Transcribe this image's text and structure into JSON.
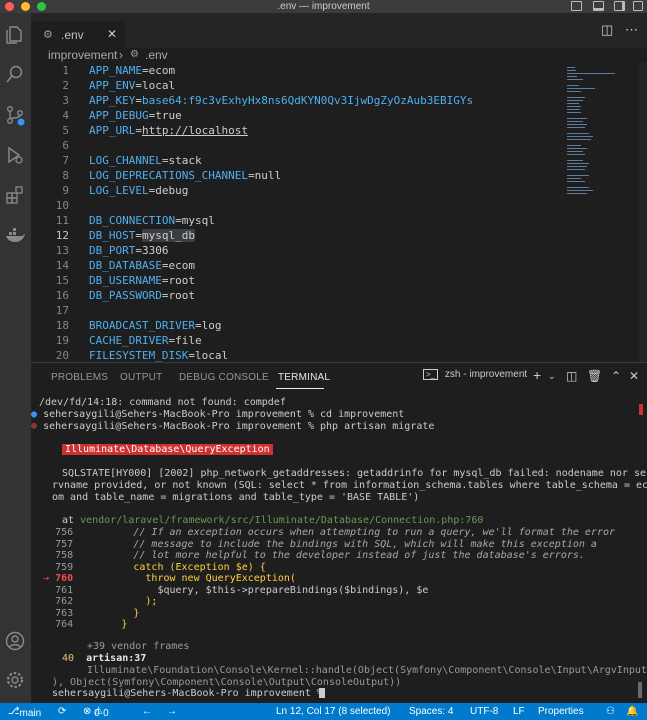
{
  "window": {
    "title": ".env — improvement"
  },
  "tab": {
    "label": ".env",
    "close": "✕"
  },
  "breadcrumb": {
    "folder": "improvement",
    "sep": "›",
    "file": ".env"
  },
  "editor": {
    "current_line": 12,
    "lines": [
      {
        "n": "1",
        "k": "APP_NAME",
        "v": "ecom"
      },
      {
        "n": "2",
        "k": "APP_ENV",
        "v": "local"
      },
      {
        "n": "3",
        "k": "APP_KEY",
        "v": "base64:f9c3vExhyHx8ns6QdKYN0Qv3IjwDgZyOzAub3EBIGYs"
      },
      {
        "n": "4",
        "k": "APP_DEBUG",
        "v": "true"
      },
      {
        "n": "5",
        "k": "APP_URL",
        "v": "http://localhost"
      },
      {
        "n": "6",
        "k": "",
        "v": ""
      },
      {
        "n": "7",
        "k": "LOG_CHANNEL",
        "v": "stack"
      },
      {
        "n": "8",
        "k": "LOG_DEPRECATIONS_CHANNEL",
        "v": "null"
      },
      {
        "n": "9",
        "k": "LOG_LEVEL",
        "v": "debug"
      },
      {
        "n": "10",
        "k": "",
        "v": ""
      },
      {
        "n": "11",
        "k": "DB_CONNECTION",
        "v": "mysql"
      },
      {
        "n": "12",
        "k": "DB_HOST",
        "v": "mysql_db"
      },
      {
        "n": "13",
        "k": "DB_PORT",
        "v": "3306"
      },
      {
        "n": "14",
        "k": "DB_DATABASE",
        "v": "ecom"
      },
      {
        "n": "15",
        "k": "DB_USERNAME",
        "v": "root"
      },
      {
        "n": "16",
        "k": "DB_PASSWORD",
        "v": "root"
      },
      {
        "n": "17",
        "k": "",
        "v": ""
      },
      {
        "n": "18",
        "k": "BROADCAST_DRIVER",
        "v": "log"
      },
      {
        "n": "19",
        "k": "CACHE_DRIVER",
        "v": "file"
      },
      {
        "n": "20",
        "k": "FILESYSTEM_DISK",
        "v": "local"
      }
    ]
  },
  "panel": {
    "tabs": [
      "PROBLEMS",
      "OUTPUT",
      "DEBUG CONSOLE",
      "TERMINAL"
    ],
    "active_tab": "TERMINAL",
    "terminal_name": "zsh - improvement"
  },
  "terminal": {
    "line1": "/dev/fd/14:18: command not found: compdef",
    "prompt1": "sehersaygili@Sehers-MacBook-Pro improvement % cd improvement",
    "prompt2": "sehersaygili@Sehers-MacBook-Pro improvement % php artisan migrate",
    "exception": "Illuminate\\Database\\QueryException",
    "sql_1": "SQLSTATE[HY000] [2002] php_network_getaddresses: getaddrinfo for mysql_db failed: nodename nor se",
    "sql_2": "rvname provided, or not known (SQL: select * from information_schema.tables where table_schema = ec",
    "sql_3": "om and table_name = migrations and table_type = 'BASE TABLE')",
    "at": "at",
    "at_path": "vendor/laravel/framework/src/Illuminate/Database/Connection.php:760",
    "code": [
      {
        "n": "756",
        "t": "// If an exception occurs when attempting to run a query, we'll format the error"
      },
      {
        "n": "757",
        "t": "// message to include the bindings with SQL, which will make this exception a"
      },
      {
        "n": "758",
        "t": "// lot more helpful to the developer instead of just the database's errors."
      },
      {
        "n": "759",
        "t": "catch (Exception $e) {"
      },
      {
        "n": "760",
        "t": "throw new QueryException("
      },
      {
        "n": "761",
        "t": "$query, $this->prepareBindings($bindings), $e"
      },
      {
        "n": "762",
        "t": ");"
      },
      {
        "n": "763",
        "t": "}"
      },
      {
        "n": "764",
        "t": "}"
      }
    ],
    "vendor_frames": "+39 vendor frames",
    "frame_num": "40",
    "frame_file": "artisan:37",
    "frame_1": "Illuminate\\Foundation\\Console\\Kernel::handle(Object(Symfony\\Component\\Console\\Input\\ArgvInput",
    "frame_2": "), Object(Symfony\\Component\\Console\\Output\\ConsoleOutput))",
    "prompt3": "sehersaygili@Sehers-MacBook-Pro improvement % "
  },
  "status": {
    "branch": "main",
    "errors": "0",
    "warnings": "0",
    "position": "Ln 12, Col 17 (8 selected)",
    "spaces": "Spaces: 4",
    "encoding": "UTF-8",
    "eol": "LF",
    "language": "Properties"
  },
  "colors": {
    "status_bar": "#007acc",
    "error_badge": "#cd3131",
    "key": "#4fb0f0"
  }
}
